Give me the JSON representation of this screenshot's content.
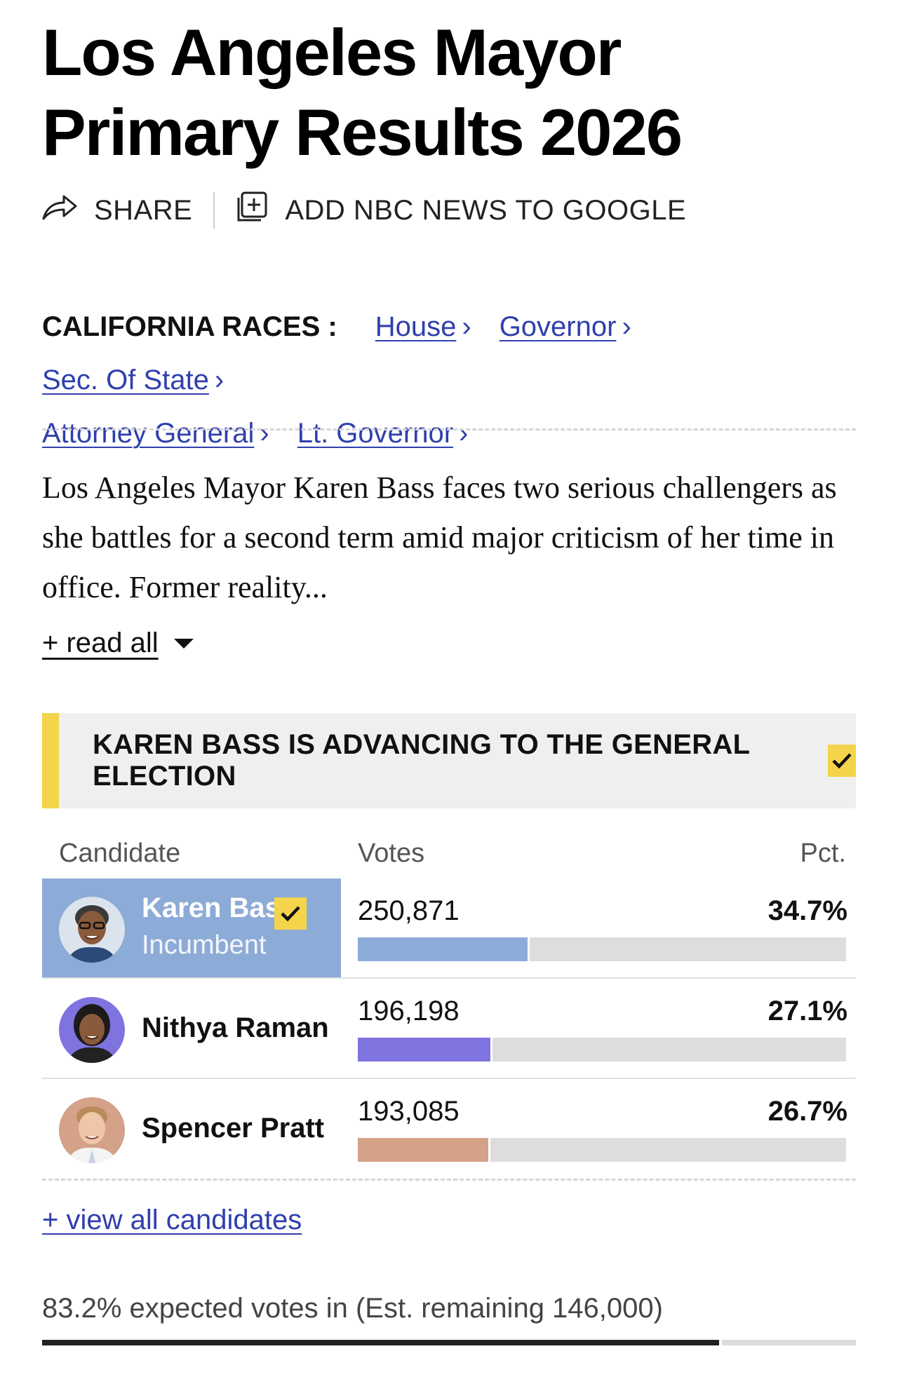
{
  "title": "Los Angeles Mayor Primary Results 2026",
  "actions": {
    "share_label": "SHARE",
    "google_label": "ADD NBC NEWS TO GOOGLE"
  },
  "races": {
    "label": "CALIFORNIA RACES :",
    "links": [
      "House",
      "Governor",
      "Sec. Of State",
      "Attorney General",
      "Lt. Governor"
    ],
    "chevron": "›"
  },
  "summary": "Los Angeles Mayor Karen Bass faces two serious challengers as she battles for a second term amid major criticism of her time in office. Former reality...",
  "read_all": "+ read all",
  "banner": {
    "text": "KAREN BASS IS ADVANCING TO THE GENERAL ELECTION",
    "accent_color": "#f4d44b"
  },
  "table": {
    "headers": {
      "candidate": "Candidate",
      "votes": "Votes",
      "pct": "Pct."
    },
    "candidates": [
      {
        "name": "Karen Bass",
        "subtitle": "Incumbent",
        "votes": "250,871",
        "pct": "34.7%",
        "share": 34.7,
        "color": "#8dabd7",
        "winner": true,
        "avatar_bg": "#dbe3ec"
      },
      {
        "name": "Nithya Raman",
        "subtitle": "",
        "votes": "196,198",
        "pct": "27.1%",
        "share": 27.1,
        "color": "#7f73e0",
        "winner": false,
        "avatar_bg": "#7f73e0"
      },
      {
        "name": "Spencer Pratt",
        "subtitle": "",
        "votes": "193,085",
        "pct": "26.7%",
        "share": 26.7,
        "color": "#d4a189",
        "winner": false,
        "avatar_bg": "#d4a189"
      }
    ]
  },
  "view_all": "+ view all candidates",
  "expected": {
    "text": "83.2% expected votes in (Est. remaining 146,000)",
    "fraction": 0.832
  },
  "icons": [
    "share-arrow-icon",
    "add-to-google-icon",
    "chevron-right-icon",
    "caret-down-icon",
    "checkmark-icon"
  ]
}
